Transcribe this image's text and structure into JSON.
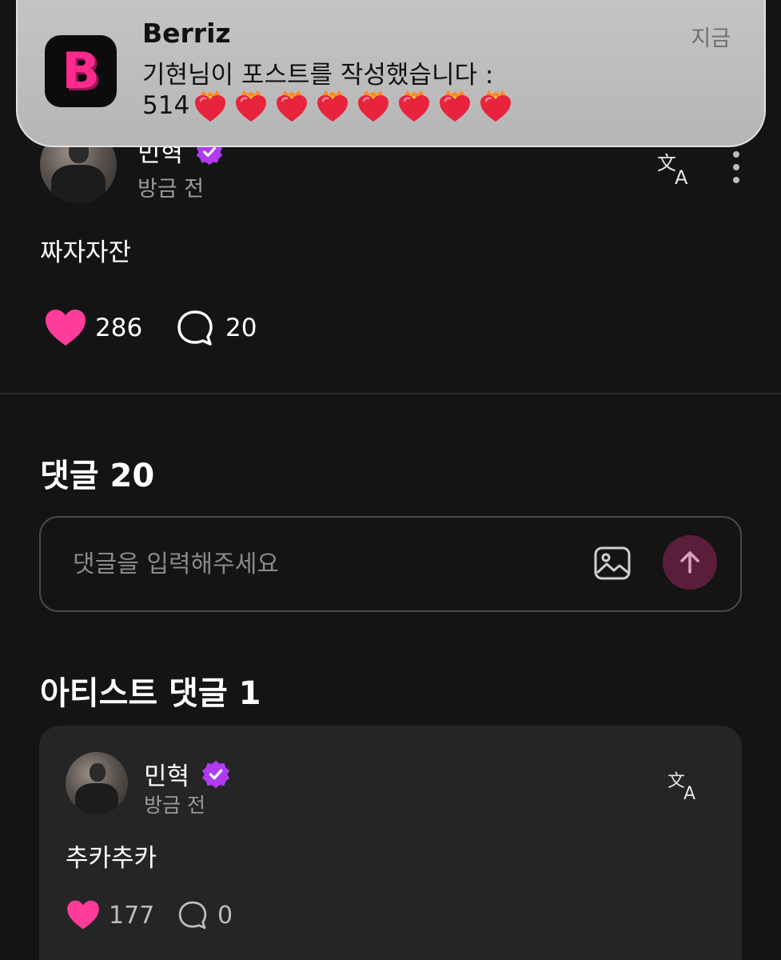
{
  "notification": {
    "app_name": "Berriz",
    "app_icon_letter": "B",
    "time": "지금",
    "message_line1": "기현님이 포스트를 작성했습니다 :",
    "message_line2_text": "514",
    "emoji_count": 8,
    "emoji": "heart-on-fire-emoji"
  },
  "post": {
    "author": "민혁",
    "time": "방금 전",
    "body": "짜자자잔",
    "likes": "286",
    "comments": "20",
    "like_color": "#ff3c99"
  },
  "comments_section": {
    "title": "댓글 20",
    "input_placeholder": "댓글을 입력해주세요"
  },
  "artist_comments": {
    "title": "아티스트 댓글 1",
    "items": [
      {
        "author": "민혁",
        "time": "방금 전",
        "body": "추카추카",
        "likes": "177",
        "replies": "0"
      }
    ]
  },
  "colors": {
    "background": "#141414",
    "accent_pink": "#ff3c99",
    "verified_badge": "#b03cf0",
    "send_button": "#5a1e3a"
  }
}
